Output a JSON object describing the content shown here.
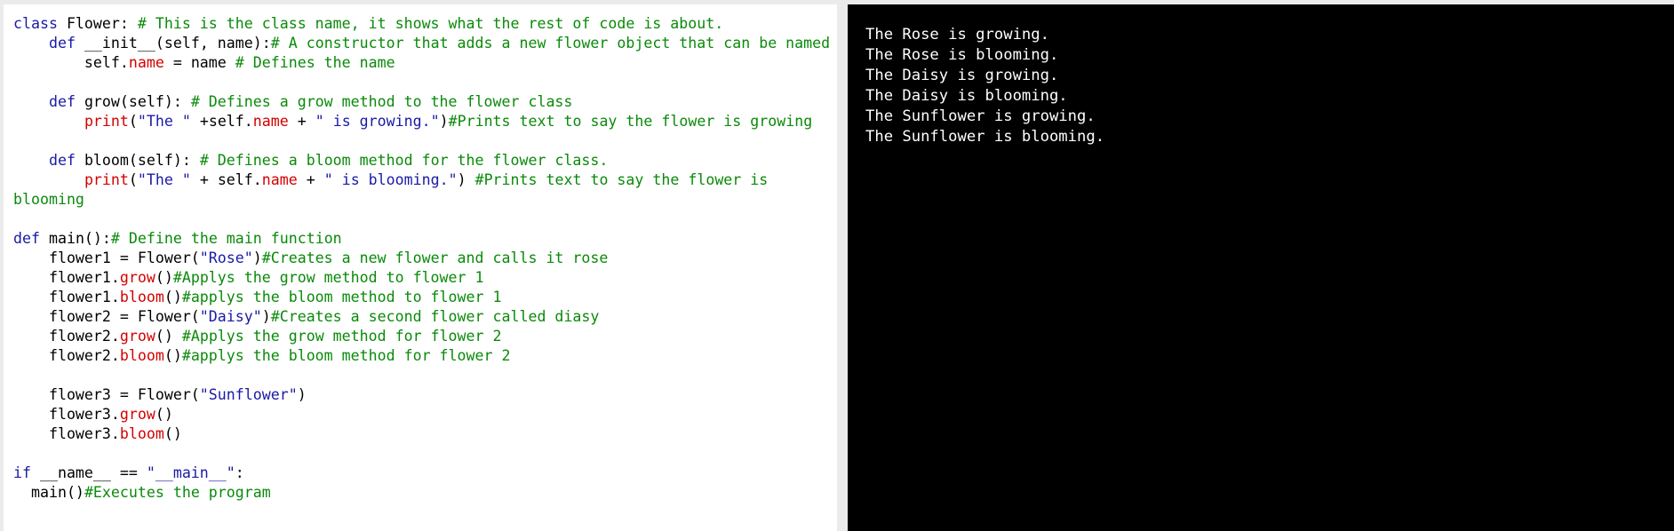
{
  "editor": {
    "lines": [
      [
        [
          "kw",
          "class"
        ],
        [
          "plain",
          " Flower: "
        ],
        [
          "cm",
          "# This is the class name, it shows what the rest of code is about."
        ]
      ],
      [
        [
          "plain",
          "    "
        ],
        [
          "kw",
          "def"
        ],
        [
          "plain",
          " __init__(self, name):"
        ],
        [
          "cm",
          "# A constructor that adds a new flower object that can be named"
        ]
      ],
      [
        [
          "plain",
          "        self."
        ],
        [
          "fn",
          "name"
        ],
        [
          "plain",
          " = name "
        ],
        [
          "cm",
          "# Defines the name"
        ]
      ],
      [],
      [
        [
          "plain",
          "    "
        ],
        [
          "kw",
          "def"
        ],
        [
          "plain",
          " grow(self): "
        ],
        [
          "cm",
          "# Defines a grow method to the flower class"
        ]
      ],
      [
        [
          "plain",
          "        "
        ],
        [
          "fn",
          "print"
        ],
        [
          "plain",
          "("
        ],
        [
          "str",
          "\"The \""
        ],
        [
          "plain",
          " +self."
        ],
        [
          "fn",
          "name"
        ],
        [
          "plain",
          " + "
        ],
        [
          "str",
          "\" is growing.\""
        ],
        [
          "plain",
          ")"
        ],
        [
          "cm",
          "#Prints text to say the flower is growing"
        ]
      ],
      [],
      [
        [
          "plain",
          "    "
        ],
        [
          "kw",
          "def"
        ],
        [
          "plain",
          " bloom(self): "
        ],
        [
          "cm",
          "# Defines a bloom method for the flower class."
        ]
      ],
      [
        [
          "plain",
          "        "
        ],
        [
          "fn",
          "print"
        ],
        [
          "plain",
          "("
        ],
        [
          "str",
          "\"The \""
        ],
        [
          "plain",
          " + self."
        ],
        [
          "fn",
          "name"
        ],
        [
          "plain",
          " + "
        ],
        [
          "str",
          "\" is blooming.\""
        ],
        [
          "plain",
          ") "
        ],
        [
          "cm",
          "#Prints text to say the flower is"
        ]
      ],
      [
        [
          "cm",
          "blooming"
        ]
      ],
      [],
      [
        [
          "kw",
          "def"
        ],
        [
          "plain",
          " main():"
        ],
        [
          "cm",
          "# Define the main function"
        ]
      ],
      [
        [
          "plain",
          "    flower1 = Flower("
        ],
        [
          "str",
          "\"Rose\""
        ],
        [
          "plain",
          ")"
        ],
        [
          "cm",
          "#Creates a new flower and calls it rose"
        ]
      ],
      [
        [
          "plain",
          "    flower1."
        ],
        [
          "fn",
          "grow"
        ],
        [
          "plain",
          "()"
        ],
        [
          "cm",
          "#Applys the grow method to flower 1"
        ]
      ],
      [
        [
          "plain",
          "    flower1."
        ],
        [
          "fn",
          "bloom"
        ],
        [
          "plain",
          "()"
        ],
        [
          "cm",
          "#applys the bloom method to flower 1"
        ]
      ],
      [
        [
          "plain",
          "    flower2 = Flower("
        ],
        [
          "str",
          "\"Daisy\""
        ],
        [
          "plain",
          ")"
        ],
        [
          "cm",
          "#Creates a second flower called diasy"
        ]
      ],
      [
        [
          "plain",
          "    flower2."
        ],
        [
          "fn",
          "grow"
        ],
        [
          "plain",
          "() "
        ],
        [
          "cm",
          "#Applys the grow method for flower 2"
        ]
      ],
      [
        [
          "plain",
          "    flower2."
        ],
        [
          "fn",
          "bloom"
        ],
        [
          "plain",
          "()"
        ],
        [
          "cm",
          "#applys the bloom method for flower 2"
        ]
      ],
      [],
      [
        [
          "plain",
          "    flower3 = Flower("
        ],
        [
          "str",
          "\"Sunflower\""
        ],
        [
          "plain",
          ")"
        ]
      ],
      [
        [
          "plain",
          "    flower3."
        ],
        [
          "fn",
          "grow"
        ],
        [
          "plain",
          "()"
        ]
      ],
      [
        [
          "plain",
          "    flower3."
        ],
        [
          "fn",
          "bloom"
        ],
        [
          "plain",
          "()"
        ]
      ],
      [],
      [
        [
          "kw",
          "if"
        ],
        [
          "plain",
          " __name__ == "
        ],
        [
          "str",
          "\"__main__\""
        ],
        [
          "plain",
          ":"
        ]
      ],
      [
        [
          "plain",
          "  main()"
        ],
        [
          "cm",
          "#Executes the program"
        ]
      ]
    ]
  },
  "console": {
    "lines": [
      "The Rose is growing.",
      "The Rose is blooming.",
      "The Daisy is growing.",
      "The Daisy is blooming.",
      "The Sunflower is growing.",
      "The Sunflower is blooming."
    ]
  },
  "colors": {
    "keyword": "#1a1aa6",
    "comment": "#0a8a0a",
    "string": "#1a1aa6",
    "function": "#d40000",
    "console_bg": "#000000",
    "console_fg": "#ffffff"
  }
}
